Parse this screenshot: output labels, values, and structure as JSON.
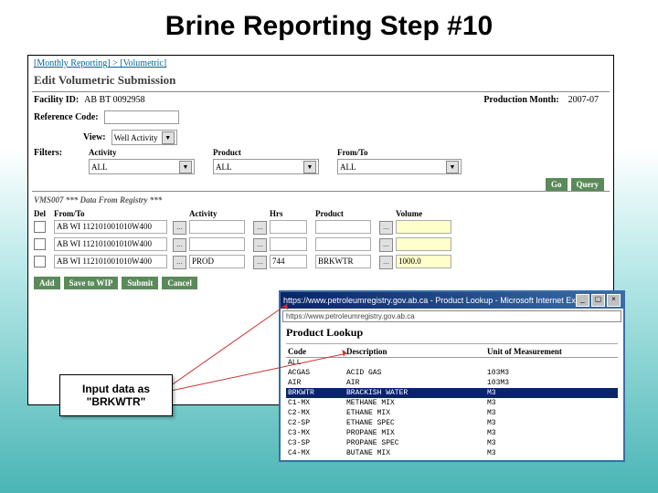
{
  "slide_title": "Brine Reporting Step #10",
  "breadcrumb": "[Monthly Reporting] > [Volumetric]",
  "page_heading": "Edit Volumetric Submission",
  "facility": {
    "label": "Facility ID:",
    "value": "AB BT 0092958"
  },
  "prod_month": {
    "label": "Production Month:",
    "value": "2007-07"
  },
  "ref_code": {
    "label": "Reference Code:",
    "value": ""
  },
  "view": {
    "label": "View:",
    "value": "Well Activity"
  },
  "filters_label": "Filters:",
  "filters": {
    "activity": {
      "label": "Activity",
      "value": "ALL"
    },
    "product": {
      "label": "Product",
      "value": "ALL"
    },
    "fromto": {
      "label": "From/To",
      "value": "ALL"
    }
  },
  "buttons": {
    "go": "Go",
    "query": "Query",
    "add": "Add",
    "save": "Save to WIP",
    "submit": "Submit",
    "cancel": "Cancel"
  },
  "registry_note": "VMS007 *** Data From Registry ***",
  "grid": {
    "headers": {
      "del": "Del",
      "fromto": "From/To",
      "activity": "Activity",
      "hrs": "Hrs",
      "product": "Product",
      "volume": "Volume"
    },
    "rows": [
      {
        "fromto": "AB WI 112101001010W400",
        "activity": "",
        "hrs": "",
        "product": "",
        "volume": ""
      },
      {
        "fromto": "AB WI 112101001010W400",
        "activity": "",
        "hrs": "",
        "product": "",
        "volume": ""
      },
      {
        "fromto": "AB WI 112101001010W400",
        "activity": "PROD",
        "hrs": "744",
        "product": "BRKWTR",
        "volume": "1000.0"
      }
    ]
  },
  "popup": {
    "title": "https://www.petroleumregistry.gov.ab.ca - Product Lookup - Microsoft Internet Explorer",
    "url": "https://www.petroleumregistry.gov.ab.ca",
    "heading": "Product Lookup",
    "columns": {
      "code": "Code",
      "desc": "Description",
      "uom": "Unit of Measurement"
    },
    "rows": [
      {
        "code": "ALL",
        "desc": "",
        "uom": ""
      },
      {
        "code": "ACGAS",
        "desc": "ACID GAS",
        "uom": "103M3"
      },
      {
        "code": "AIR",
        "desc": "AIR",
        "uom": "103M3"
      },
      {
        "code": "BRKWTR",
        "desc": "BRACKISH WATER",
        "uom": "M3"
      },
      {
        "code": "C1-MX",
        "desc": "METHANE MIX",
        "uom": "M3"
      },
      {
        "code": "C2-MX",
        "desc": "ETHANE MIX",
        "uom": "M3"
      },
      {
        "code": "C2-SP",
        "desc": "ETHANE SPEC",
        "uom": "M3"
      },
      {
        "code": "C3-MX",
        "desc": "PROPANE MIX",
        "uom": "M3"
      },
      {
        "code": "C3-SP",
        "desc": "PROPANE SPEC",
        "uom": "M3"
      },
      {
        "code": "C4-MX",
        "desc": "BUTANE MIX",
        "uom": "M3"
      }
    ],
    "selected_index": 3
  },
  "callout": "Input data as \"BRKWTR\""
}
